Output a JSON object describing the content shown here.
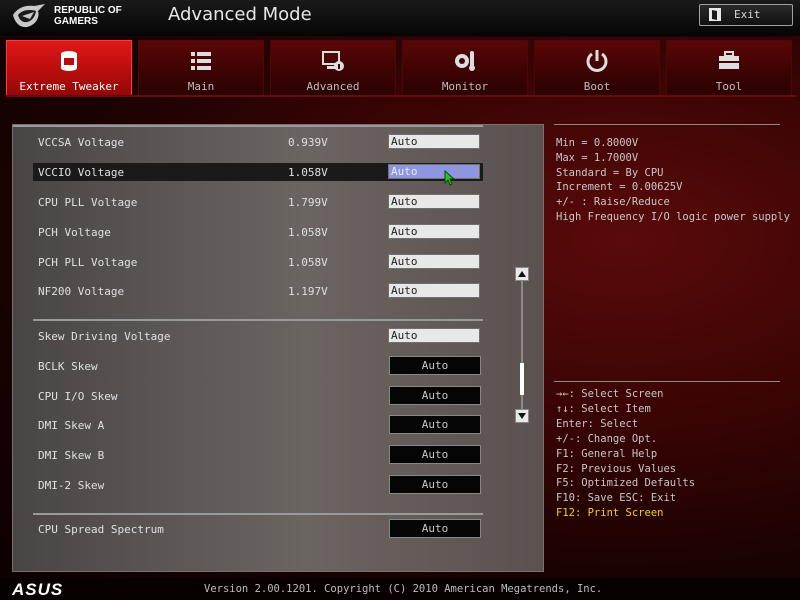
{
  "header": {
    "brand": "REPUBLIC OF\nGAMERS",
    "title": "Advanced Mode",
    "exit_label": "Exit"
  },
  "tabs": [
    {
      "label": "Extreme Tweaker",
      "icon": "cpu-tweaker-icon",
      "active": true
    },
    {
      "label": "Main",
      "icon": "list-icon",
      "active": false
    },
    {
      "label": "Advanced",
      "icon": "advanced-settings-icon",
      "active": false
    },
    {
      "label": "Monitor",
      "icon": "temperature-monitor-icon",
      "active": false
    },
    {
      "label": "Boot",
      "icon": "power-icon",
      "active": false
    },
    {
      "label": "Tool",
      "icon": "toolbox-icon",
      "active": false
    }
  ],
  "settings": {
    "voltages": [
      {
        "label": "VCCSA Voltage",
        "value": "0.939V",
        "field": "Auto"
      },
      {
        "label": "VCCIO Voltage",
        "value": "1.058V",
        "field": "Auto",
        "selected": true
      },
      {
        "label": "CPU PLL Voltage",
        "value": "1.799V",
        "field": "Auto"
      },
      {
        "label": "PCH Voltage",
        "value": "1.058V",
        "field": "Auto"
      },
      {
        "label": "PCH PLL Voltage",
        "value": "1.058V",
        "field": "Auto"
      },
      {
        "label": "NF200 Voltage",
        "value": "1.197V",
        "field": "Auto"
      }
    ],
    "skew": [
      {
        "label": "Skew Driving Voltage",
        "field": "Auto"
      },
      {
        "label": "BCLK Skew",
        "field": "Auto"
      },
      {
        "label": "CPU I/O Skew",
        "field": "Auto"
      },
      {
        "label": "DMI Skew A",
        "field": "Auto"
      },
      {
        "label": "DMI Skew B",
        "field": "Auto"
      },
      {
        "label": "DMI-2 Skew",
        "field": "Auto"
      }
    ],
    "spread": [
      {
        "label": "CPU Spread Spectrum",
        "field": "Auto"
      }
    ]
  },
  "scroll_position": 0.85,
  "help": {
    "lines": [
      "Min = 0.8000V",
      "Max = 1.7000V",
      "Standard = By CPU",
      "Increment = 0.00625V",
      "+/- : Raise/Reduce",
      "High Frequency I/O logic power supply"
    ]
  },
  "keys": {
    "lines": [
      "→←: Select Screen",
      "↑↓: Select Item",
      "Enter: Select",
      "+/-: Change Opt.",
      "F1: General Help",
      "F2: Previous Values",
      "F5: Optimized Defaults",
      "F10: Save  ESC: Exit"
    ],
    "f12": "F12: Print Screen"
  },
  "footer": {
    "brand": "ASUS",
    "copyright": "Version 2.00.1201. Copyright (C) 2010 American Megatrends, Inc."
  },
  "colors": {
    "accent_red": "#d01010",
    "highlight_field": "#8f96e0",
    "f12_yellow": "#f0d020"
  }
}
